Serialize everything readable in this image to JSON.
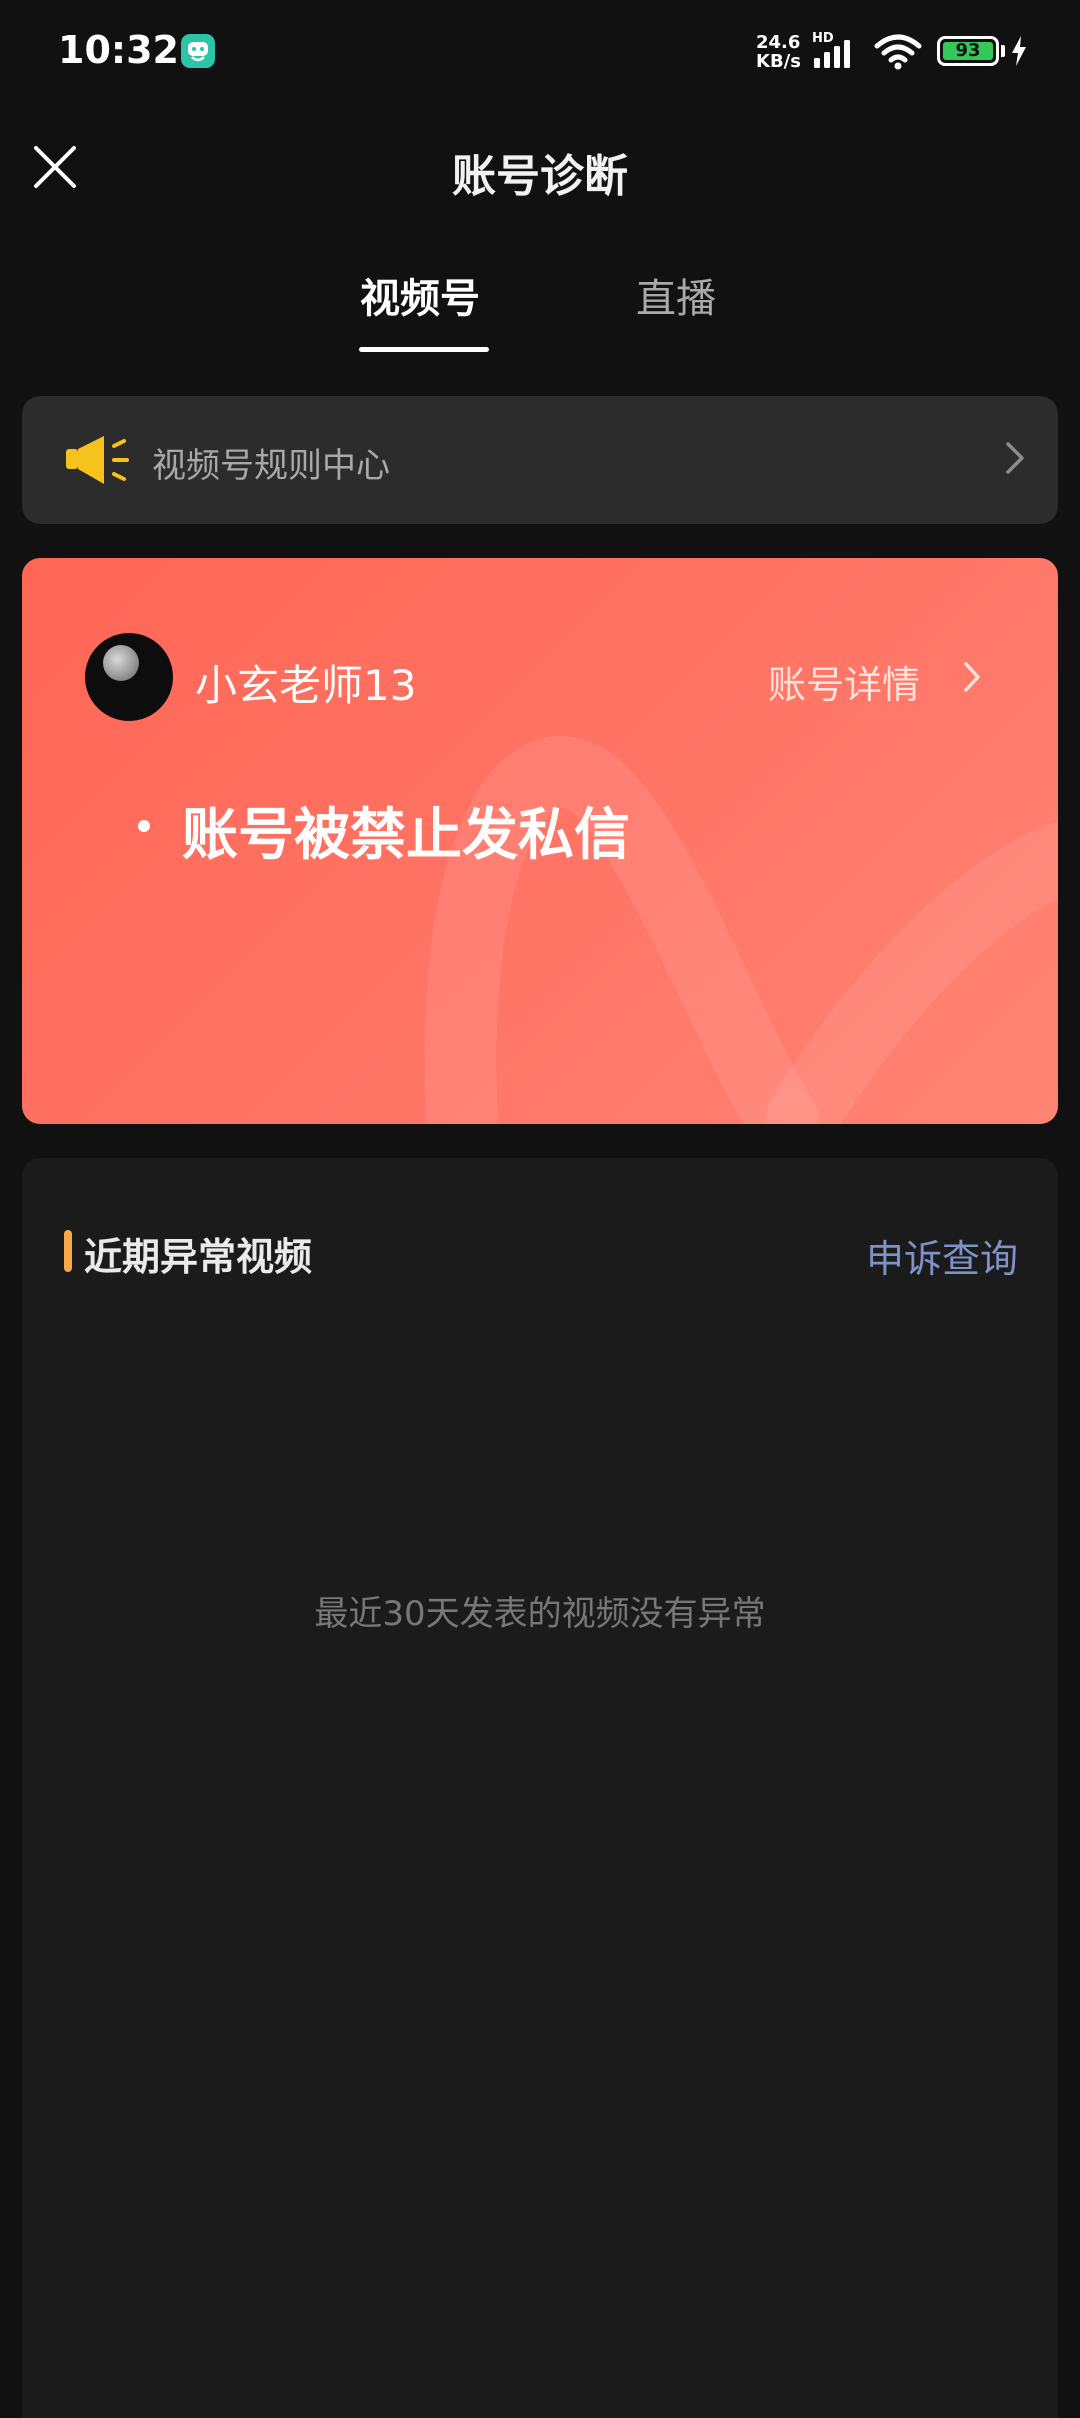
{
  "status_bar": {
    "time": "10:32",
    "net_speed_value": "24.6",
    "net_speed_unit": "KB/s",
    "hd_label": "HD",
    "battery": "93",
    "app_icon": "app-notification-icon",
    "icons": [
      "signal-icon",
      "wifi-icon",
      "battery-icon",
      "charging-icon"
    ]
  },
  "header": {
    "title": "账号诊断",
    "close_icon": "close-icon"
  },
  "tabs": [
    {
      "label": "视频号",
      "selected": true
    },
    {
      "label": "直播",
      "selected": false
    }
  ],
  "rule_center": {
    "label": "视频号规则中心",
    "icon": "speaker-icon",
    "chevron_icon": "chevron-right-icon"
  },
  "alert_card": {
    "username": "小玄老师13",
    "detail_link": "账号详情",
    "issues": [
      "账号被禁止发私信"
    ]
  },
  "abnormal_videos": {
    "title": "近期异常视频",
    "appeal_link": "申诉查询",
    "empty_message": "最近30天发表的视频没有异常"
  },
  "colors": {
    "background": "#111111",
    "card_gradient_start": "#ff6655",
    "card_gradient_end": "#ff8474",
    "accent_orange": "#f7a94a",
    "link_blue": "#7d92c6",
    "speaker_yellow": "#f6c21c"
  }
}
